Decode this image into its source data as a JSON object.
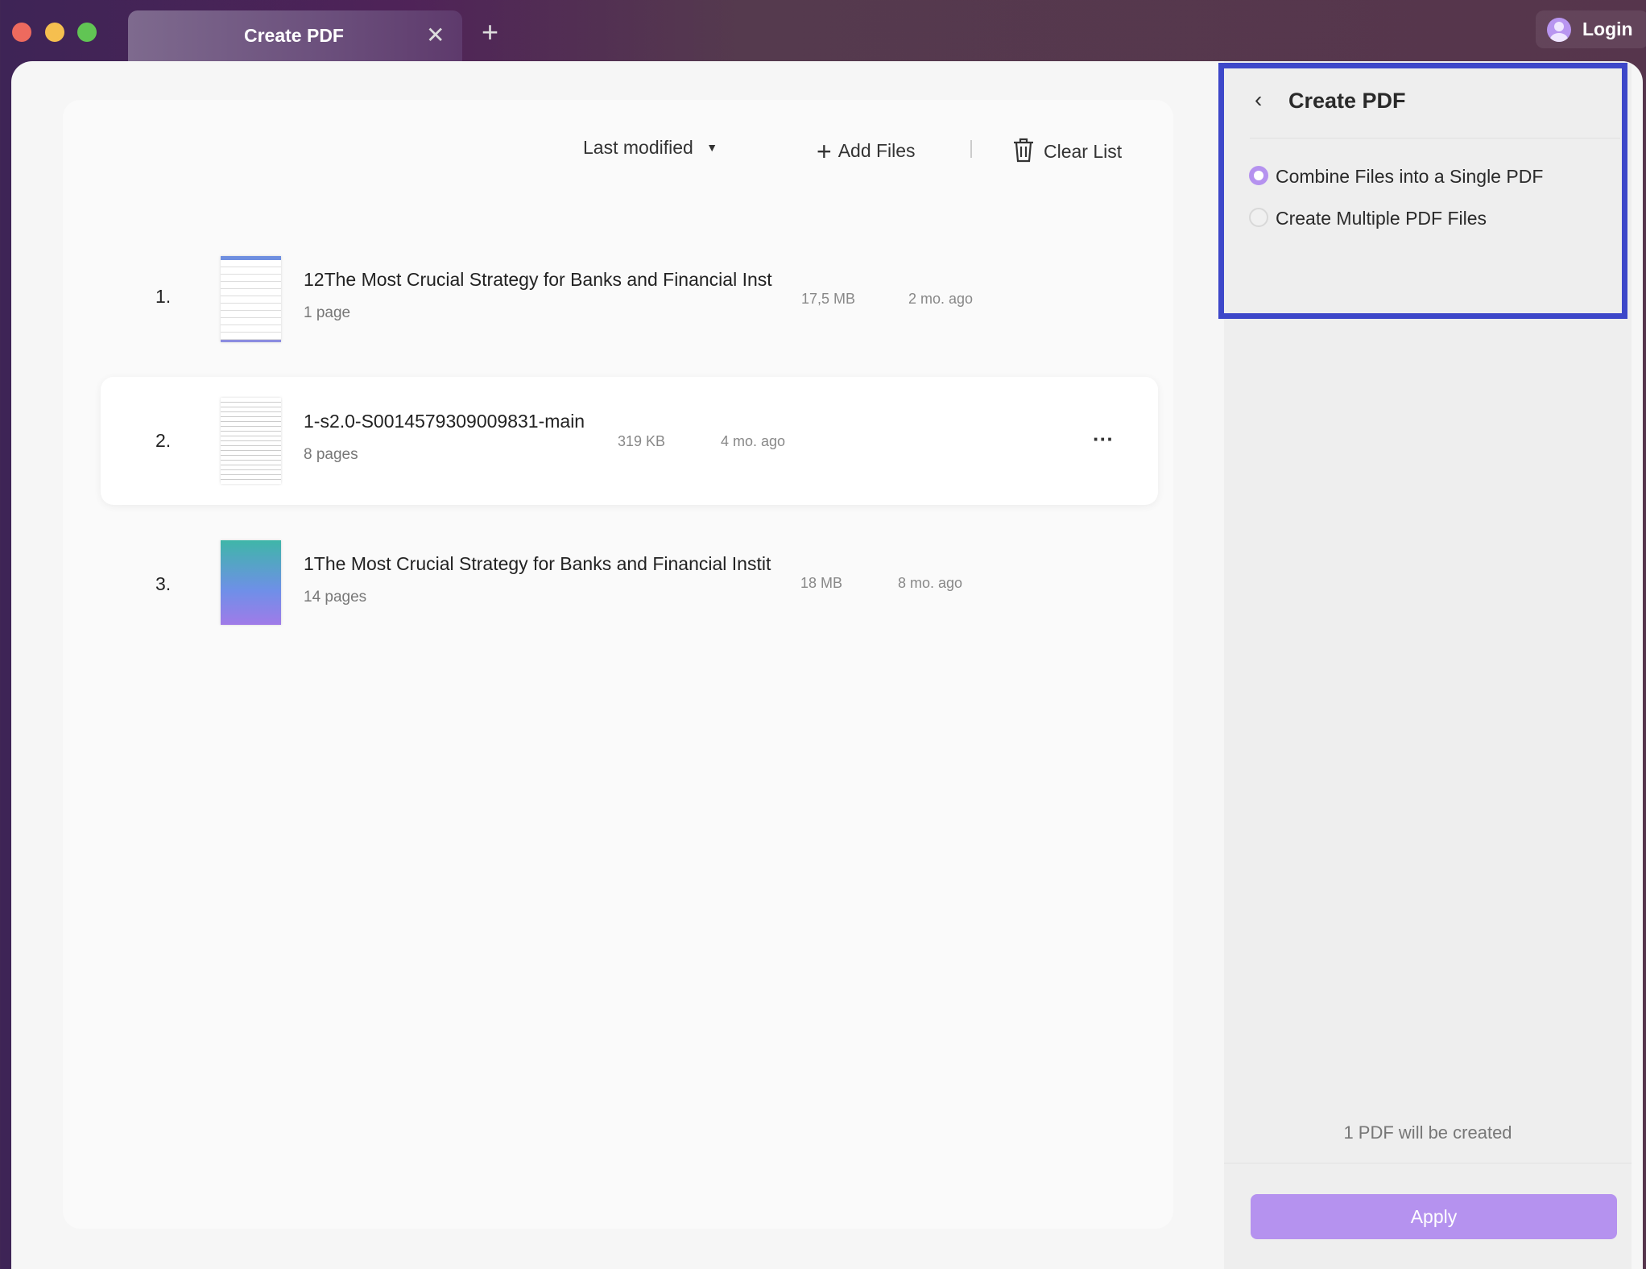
{
  "window": {
    "tab_title": "Create PDF",
    "login_label": "Login"
  },
  "toolbar": {
    "sort_label": "Last modified",
    "add_files_label": "Add Files",
    "clear_list_label": "Clear List"
  },
  "files": [
    {
      "index": "1.",
      "name": "12The Most Crucial Strategy for Banks and Financial Inst",
      "pages": "1 page",
      "size": "17,5 MB",
      "modified": "2 mo. ago"
    },
    {
      "index": "2.",
      "name": "1-s2.0-S0014579309009831-main",
      "pages": "8 pages",
      "size": "319 KB",
      "modified": "4 mo. ago",
      "more": "···"
    },
    {
      "index": "3.",
      "name": "1The Most Crucial Strategy for Banks and Financial Instit",
      "pages": "14 pages",
      "size": "18 MB",
      "modified": "8 mo. ago"
    }
  ],
  "panel": {
    "title": "Create PDF",
    "options": [
      {
        "label": "Combine Files into a Single PDF",
        "selected": true
      },
      {
        "label": "Create Multiple PDF Files",
        "selected": false
      }
    ],
    "summary": "1 PDF will be created",
    "apply_label": "Apply"
  },
  "colors": {
    "accent": "#b592ef",
    "highlight": "#3d47c9"
  }
}
